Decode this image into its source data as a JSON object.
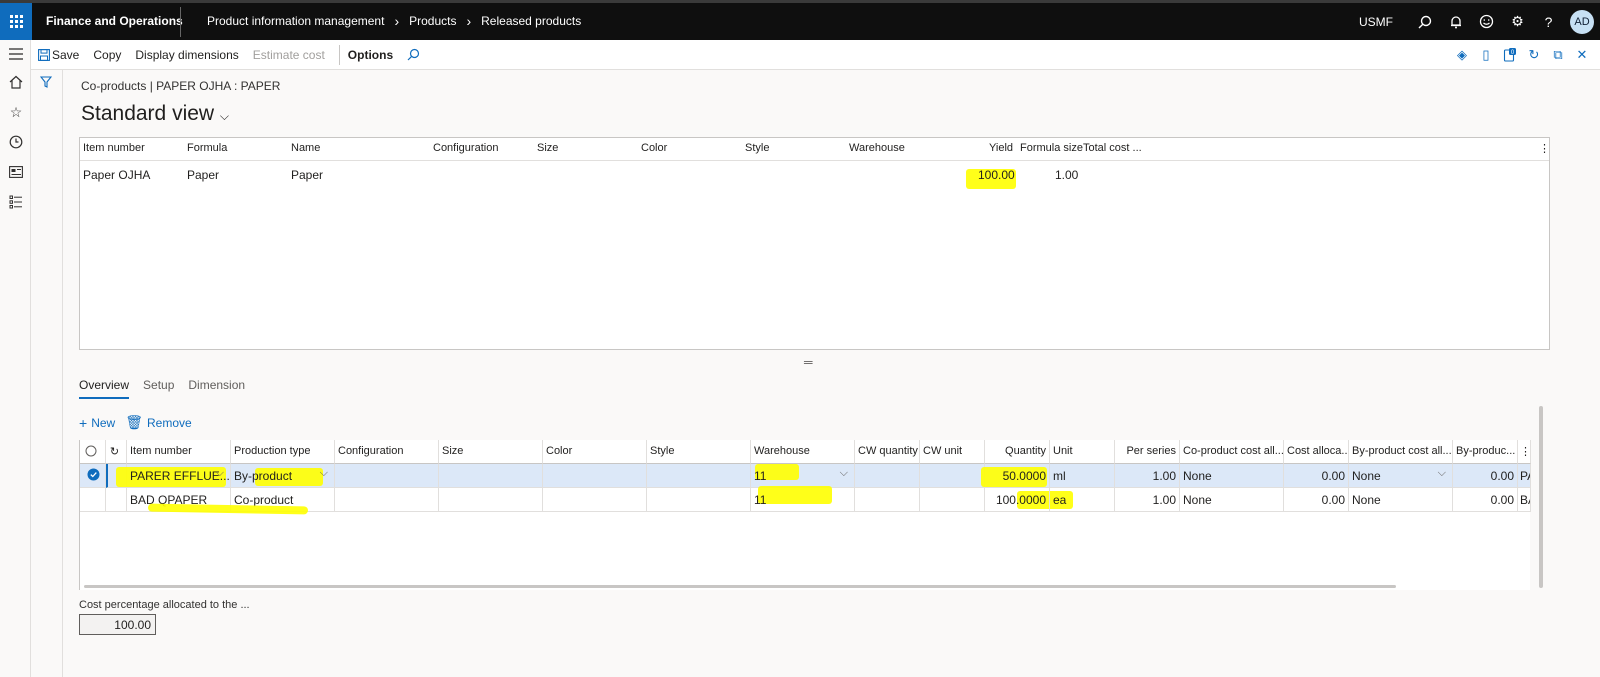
{
  "topbar": {
    "app_title": "Finance and Operations",
    "breadcrumb": [
      "Product information management",
      "Products",
      "Released products"
    ],
    "company": "USMF",
    "avatar_initials": "AD"
  },
  "actionbar": {
    "save": "Save",
    "copy": "Copy",
    "display_dimensions": "Display dimensions",
    "estimate_cost": "Estimate cost",
    "options": "Options"
  },
  "page": {
    "caption": "Co-products  |  PAPER OJHA : PAPER",
    "view_title": "Standard view"
  },
  "top_grid": {
    "headers": [
      "Item number",
      "Formula",
      "Name",
      "Configuration",
      "Size",
      "Color",
      "Style",
      "Warehouse",
      "Yield",
      "Formula size",
      "Total cost ..."
    ],
    "row": {
      "item_number": "Paper OJHA",
      "formula": "Paper",
      "name": "Paper",
      "yield": "100.00",
      "formula_size": "1.00"
    }
  },
  "tabs": [
    "Overview",
    "Setup",
    "Dimension"
  ],
  "line_actions": {
    "new": "New",
    "remove": "Remove"
  },
  "lines_grid": {
    "headers": [
      "Item number",
      "Production type",
      "Configuration",
      "Size",
      "Color",
      "Style",
      "Warehouse",
      "CW quantity",
      "CW unit",
      "Quantity",
      "Unit",
      "Per series",
      "Co-product cost all...",
      "Cost alloca...",
      "By-product cost all...",
      "By-produc..."
    ],
    "rows": [
      {
        "item_number": "PARER EFFLUE...",
        "production_type": "By-product",
        "warehouse": "11",
        "quantity": "50.0000",
        "unit": "ml",
        "per_series": "1.00",
        "coproduct_cost_alloc": "None",
        "cost_alloc": "0.00",
        "byproduct_cost_alloc": "None",
        "byproduct": "0.00",
        "overflow": "PA"
      },
      {
        "item_number": "BAD QPAPER",
        "production_type": "Co-product",
        "warehouse": "11",
        "quantity": "100.0000",
        "unit": "ea",
        "per_series": "1.00",
        "coproduct_cost_alloc": "None",
        "cost_alloc": "0.00",
        "byproduct_cost_alloc": "None",
        "byproduct": "0.00",
        "overflow": "BA"
      }
    ]
  },
  "cost_percentage": {
    "label": "Cost percentage allocated to the ...",
    "value": "100.00"
  },
  "colors": {
    "accent": "#0f6cbd",
    "topbar": "#0f0f0f",
    "highlight": "#ffff00",
    "selected_row": "#dce8f8"
  }
}
